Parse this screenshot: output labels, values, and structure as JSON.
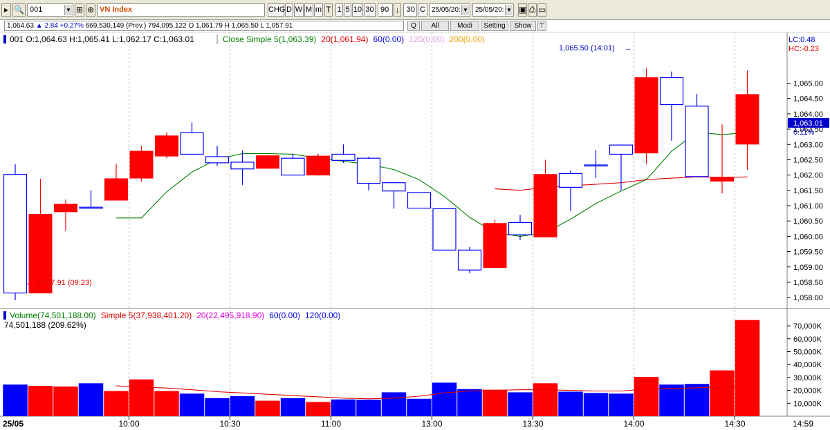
{
  "toolbar": {
    "symbol_field": "001",
    "index_name": "VN Index",
    "buttons": [
      "CHG",
      "D",
      "W",
      "M",
      "m"
    ],
    "period_buttons": [
      "1",
      "5",
      "10",
      "30"
    ],
    "bars_count": "90",
    "bars_visible": "30",
    "period_unit": "C",
    "date_from": "25/05/20:",
    "date_to": "25/05/20:"
  },
  "quote_bar": {
    "last": "1,064.63",
    "change": "2.84 +0.27%",
    "rest": "669,530,149 (Prev.) 794,095,122 O 1,061.79 H 1,065.50 L 1,057.91",
    "buttons": [
      "Q",
      "All",
      "Modi",
      "Setting",
      "Show"
    ]
  },
  "price_panel": {
    "ohlc_label": "001 O:1,064.63 H:1,065.41 L:1,062.17 C:1,063.01",
    "ma_labels": [
      {
        "text": "Close Simple 5(1,063.39)",
        "color": "#008000"
      },
      {
        "text": "20(1,061.94)",
        "color": "#e00000"
      },
      {
        "text": "60(0.00)",
        "color": "#0000e0"
      },
      {
        "text": "120(0.00)",
        "color": "#d9a0e0"
      },
      {
        "text": "200(0.00)",
        "color": "#f0a000"
      }
    ],
    "lc_label": "LC:0.48",
    "hc_label": "HC:-0.23",
    "high_annotation": "1,065.50 (14:01)",
    "low_annotation": "1,057.91 (09:23)",
    "last_price_tag": "1,063.01",
    "last_pct_tag": "0.11%"
  },
  "volume_panel": {
    "labels": [
      {
        "text": "Volume(74,501,188.00)",
        "color": "#008000"
      },
      {
        "text": "Simple 5(37,938,401.20)",
        "color": "#e00000"
      },
      {
        "text": "20(22,495,918.90)",
        "color": "#e000e0"
      },
      {
        "text": "60(0.00)",
        "color": "#0000e0"
      },
      {
        "text": "120(0.00)",
        "color": "#0000e0"
      }
    ],
    "last_volume_label": "74,501,188 (209.62%)"
  },
  "x_axis": {
    "date_label": "25/05",
    "time_labels": [
      "10:00",
      "10:30",
      "11:00",
      "13:00",
      "13:30",
      "14:00",
      "14:30"
    ],
    "right_label": "14:59"
  },
  "colors": {
    "up": "#ff0000",
    "down": "#0000ff",
    "ma5": "#008000",
    "ma20": "#e00000",
    "vol_ma20": "#e000e0"
  },
  "chart_data": [
    {
      "type": "candlestick",
      "ylim": [
        1057.8,
        1065.8
      ],
      "yticks": [
        "1,058.00",
        "1,058.50",
        "1,059.00",
        "1,059.50",
        "1,060.00",
        "1,060.50",
        "1,061.00",
        "1,061.50",
        "1,062.00",
        "1,062.50",
        "1,063.00",
        "1,063.50",
        "1,064.00",
        "1,064.50",
        "1,065.00"
      ],
      "candles": [
        {
          "o": 1058.15,
          "h": 1062.35,
          "l": 1057.91,
          "c": 1062.02
        },
        {
          "o": 1060.72,
          "h": 1061.88,
          "l": 1058.15,
          "c": 1058.15
        },
        {
          "o": 1061.05,
          "h": 1061.2,
          "l": 1060.18,
          "c": 1060.8
        },
        {
          "o": 1060.93,
          "h": 1061.5,
          "l": 1060.93,
          "c": 1060.95
        },
        {
          "o": 1061.88,
          "h": 1062.35,
          "l": 1061.18,
          "c": 1061.18
        },
        {
          "o": 1062.78,
          "h": 1062.95,
          "l": 1061.78,
          "c": 1061.9
        },
        {
          "o": 1063.28,
          "h": 1063.4,
          "l": 1062.55,
          "c": 1062.62
        },
        {
          "o": 1062.68,
          "h": 1063.72,
          "l": 1062.68,
          "c": 1063.38
        },
        {
          "o": 1062.4,
          "h": 1062.95,
          "l": 1062.3,
          "c": 1062.6
        },
        {
          "o": 1062.2,
          "h": 1062.8,
          "l": 1061.68,
          "c": 1062.42
        },
        {
          "o": 1062.63,
          "h": 1062.65,
          "l": 1062.22,
          "c": 1062.22
        },
        {
          "o": 1062.0,
          "h": 1062.7,
          "l": 1061.98,
          "c": 1062.55
        },
        {
          "o": 1062.62,
          "h": 1062.7,
          "l": 1061.98,
          "c": 1062.0
        },
        {
          "o": 1062.48,
          "h": 1063.0,
          "l": 1062.4,
          "c": 1062.68
        },
        {
          "o": 1061.73,
          "h": 1062.6,
          "l": 1061.5,
          "c": 1062.55
        },
        {
          "o": 1061.48,
          "h": 1061.73,
          "l": 1060.9,
          "c": 1061.75
        },
        {
          "o": 1060.92,
          "h": 1061.4,
          "l": 1060.92,
          "c": 1061.43
        },
        {
          "o": 1059.55,
          "h": 1060.9,
          "l": 1059.55,
          "c": 1060.9
        },
        {
          "o": 1058.9,
          "h": 1059.65,
          "l": 1058.8,
          "c": 1059.55
        },
        {
          "o": 1060.42,
          "h": 1060.55,
          "l": 1058.98,
          "c": 1058.98
        },
        {
          "o": 1060.05,
          "h": 1060.7,
          "l": 1059.88,
          "c": 1060.45
        },
        {
          "o": 1062.02,
          "h": 1062.5,
          "l": 1059.98,
          "c": 1059.98
        },
        {
          "o": 1061.6,
          "h": 1062.15,
          "l": 1060.83,
          "c": 1062.05
        },
        {
          "o": 1062.33,
          "h": 1062.82,
          "l": 1061.9,
          "c": 1062.33
        },
        {
          "o": 1062.68,
          "h": 1063.0,
          "l": 1061.5,
          "c": 1062.98
        },
        {
          "o": 1065.18,
          "h": 1065.5,
          "l": 1062.35,
          "c": 1062.72
        },
        {
          "o": 1064.3,
          "h": 1065.38,
          "l": 1063.12,
          "c": 1065.18
        },
        {
          "o": 1061.95,
          "h": 1064.65,
          "l": 1061.95,
          "c": 1064.25
        },
        {
          "o": 1061.93,
          "h": 1063.65,
          "l": 1061.4,
          "c": 1061.8
        },
        {
          "o": 1064.63,
          "h": 1065.41,
          "l": 1062.17,
          "c": 1063.01
        }
      ],
      "ma5": [
        null,
        null,
        null,
        null,
        1060.6,
        1060.6,
        1061.45,
        1062.1,
        1062.52,
        1062.7,
        1062.7,
        1062.68,
        1062.55,
        1062.45,
        1062.35,
        1062.18,
        1061.85,
        1061.3,
        1060.62,
        1060.12,
        1060.0,
        1060.12,
        1060.56,
        1061.07,
        1061.48,
        1061.85,
        1062.78,
        1063.4,
        1063.32,
        1063.39
      ],
      "ma20": [
        null,
        null,
        null,
        null,
        null,
        null,
        null,
        null,
        null,
        null,
        null,
        null,
        null,
        null,
        null,
        null,
        null,
        null,
        null,
        1061.55,
        1061.5,
        1061.6,
        1061.65,
        1061.7,
        1061.75,
        1061.85,
        1061.9,
        1061.94,
        1061.92,
        1061.94
      ]
    },
    {
      "type": "bar",
      "ylim": [
        0,
        77000
      ],
      "yticks": [
        "10,000K",
        "20,000K",
        "30,000K",
        "40,000K",
        "50,000K",
        "60,000K",
        "70,000K"
      ],
      "ytick_values": [
        10000,
        20000,
        30000,
        40000,
        50000,
        60000,
        70000
      ],
      "volumes": [
        24500,
        23500,
        23000,
        25500,
        19500,
        28500,
        19500,
        17500,
        14000,
        15500,
        12000,
        14000,
        11000,
        13000,
        12800,
        18500,
        13500,
        26000,
        21000,
        20500,
        18500,
        25500,
        19000,
        18000,
        17500,
        30500,
        24500,
        25000,
        35500,
        74501
      ],
      "ma20": [
        null,
        null,
        null,
        null,
        23500,
        22500,
        21800,
        20500,
        19000,
        18000,
        17000,
        16000,
        15000,
        14000,
        13500,
        14000,
        15500,
        18000,
        19500,
        20000,
        20500,
        20500,
        20000,
        19500,
        19500,
        21000,
        21500,
        22000,
        22500,
        22496
      ]
    }
  ]
}
